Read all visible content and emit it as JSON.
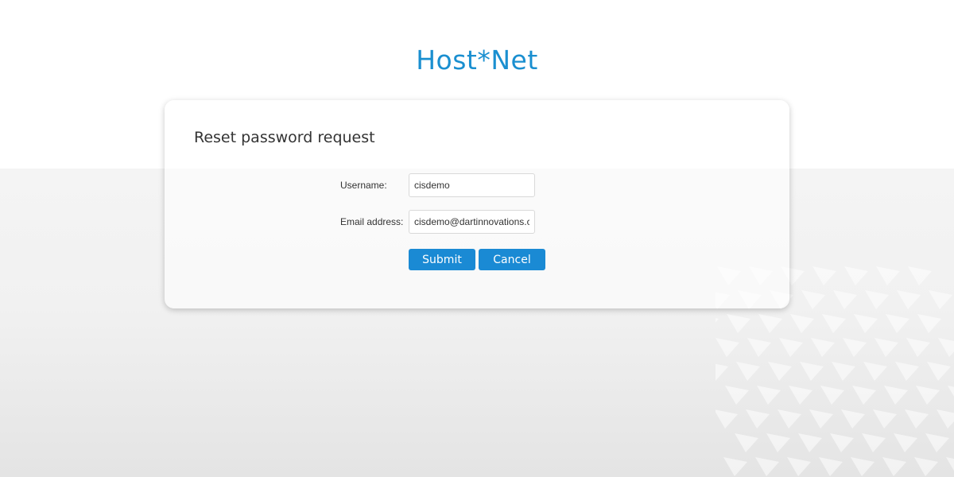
{
  "brand": {
    "logo_text": "Host*Net"
  },
  "form": {
    "title": "Reset password request",
    "username": {
      "label": "Username:",
      "value": "cisdemo"
    },
    "email": {
      "label": "Email address:",
      "value": "cisdemo@dartinnovations.com"
    },
    "submit_label": "Submit",
    "cancel_label": "Cancel"
  },
  "colors": {
    "accent": "#1a8ad4",
    "logo": "#1a8fd0"
  }
}
